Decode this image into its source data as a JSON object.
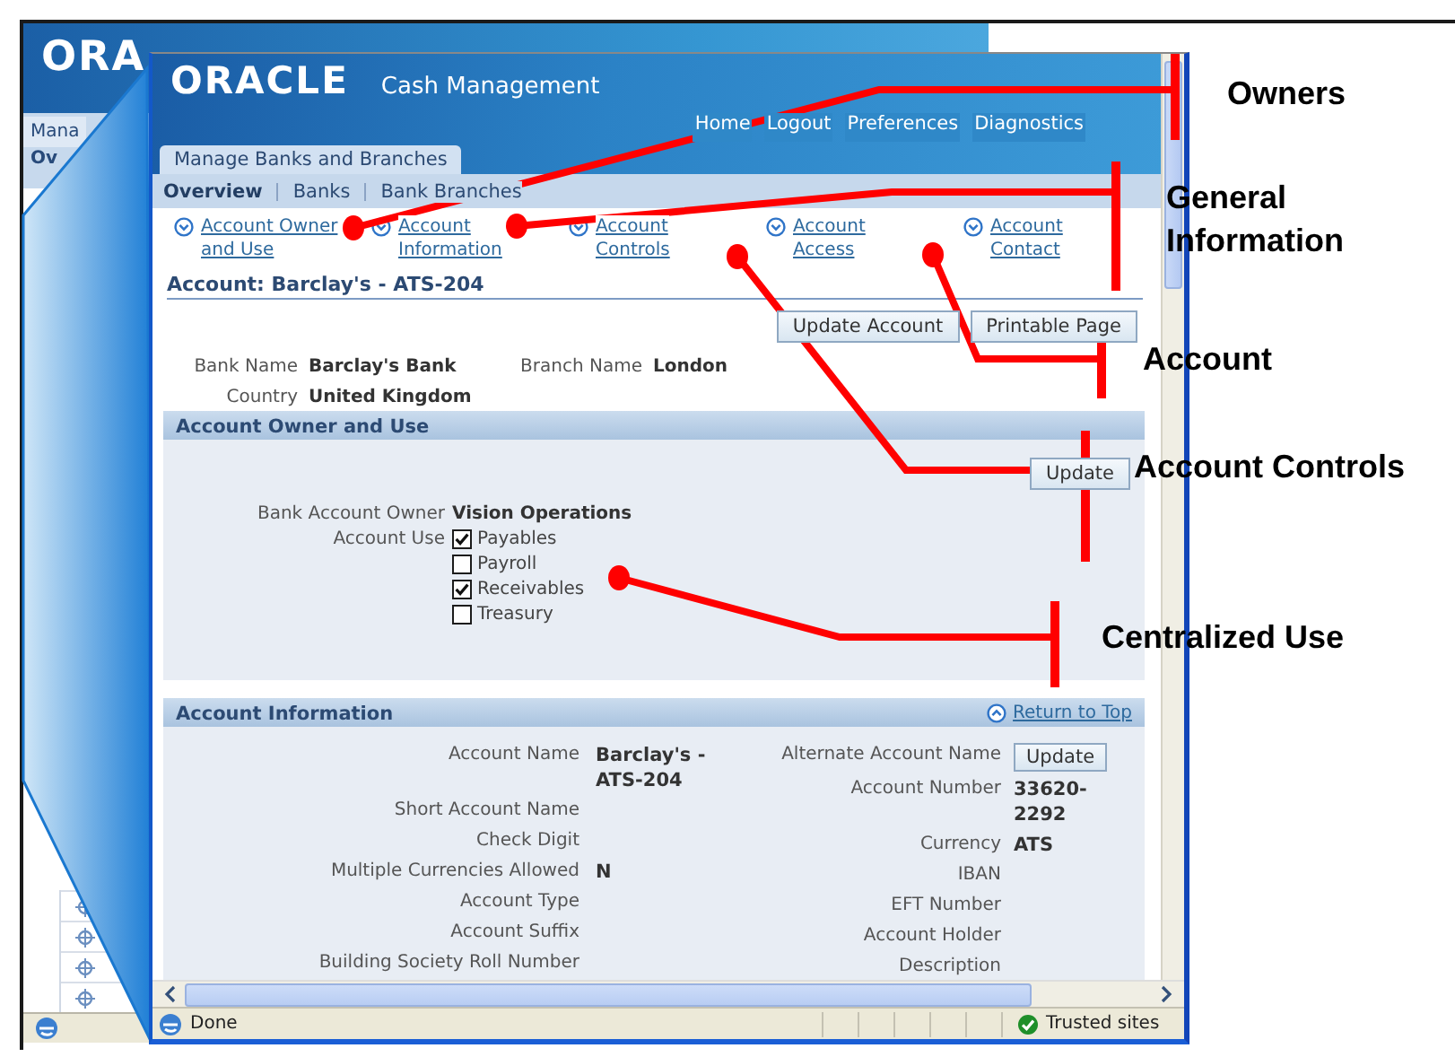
{
  "back_window": {
    "logo": "ORA",
    "tab": "Mana",
    "subtab": "Ov"
  },
  "window": {
    "logo": "ORACLE",
    "app_title": "Cash Management",
    "global_links": [
      "Home",
      "Logout",
      "Preferences",
      "Diagnostics"
    ],
    "tabs": [
      {
        "label": "Manage Banks and Branches",
        "selected": true
      }
    ],
    "subtabs": [
      {
        "label": "Overview",
        "selected": true
      },
      {
        "label": "Banks",
        "selected": false
      },
      {
        "label": "Bank Branches",
        "selected": false
      }
    ],
    "quick_links": [
      "Account Owner\nand Use",
      "Account\nInformation",
      "Account\nControls",
      "Account\nAccess",
      "Account\nContact"
    ],
    "page_title": "Account: Barclay's - ATS-204",
    "buttons": [
      "Update Account",
      "Printable Page"
    ],
    "bank_fields": [
      {
        "label": "Bank Name",
        "value": "Barclay's Bank"
      },
      {
        "label": "Branch Name",
        "value": "London"
      },
      {
        "label": "Country",
        "value": "United Kingdom"
      }
    ],
    "owner_section": {
      "title": "Account Owner and Use",
      "button": "Update",
      "owner_label": "Bank Account Owner",
      "owner_value": "Vision Operations",
      "use_label": "Account Use",
      "uses": [
        {
          "label": "Payables",
          "checked": true
        },
        {
          "label": "Payroll",
          "checked": false
        },
        {
          "label": "Receivables",
          "checked": true
        },
        {
          "label": "Treasury",
          "checked": false
        }
      ]
    },
    "info_section": {
      "title": "Account Information",
      "return_link": "Return to Top",
      "button": "Update",
      "left_fields": [
        {
          "label": "Account Name",
          "value": "Barclay's - ATS-204"
        },
        {
          "label": "Short Account Name"
        },
        {
          "label": "Check Digit"
        },
        {
          "label": "Multiple Currencies Allowed",
          "value": "N"
        },
        {
          "label": "Account Type"
        },
        {
          "label": "Account Suffix"
        },
        {
          "label": "Building Society Roll Number"
        }
      ],
      "right_fields": [
        {
          "label": "Alternate Account Name",
          "kind": "button"
        },
        {
          "label": "Account Number",
          "value": "33620-2292"
        },
        {
          "label": "Currency",
          "value": "ATS"
        },
        {
          "label": "IBAN"
        },
        {
          "label": "EFT Number"
        },
        {
          "label": "Account Holder"
        },
        {
          "label": "Description"
        }
      ]
    },
    "status_bar": {
      "text": "Done",
      "zone": "Trusted sites"
    }
  },
  "callouts": [
    {
      "label": "Owners"
    },
    {
      "label": "General Information"
    },
    {
      "label": "Account"
    },
    {
      "label": "Account Controls"
    },
    {
      "label": "Centralized Use"
    }
  ]
}
